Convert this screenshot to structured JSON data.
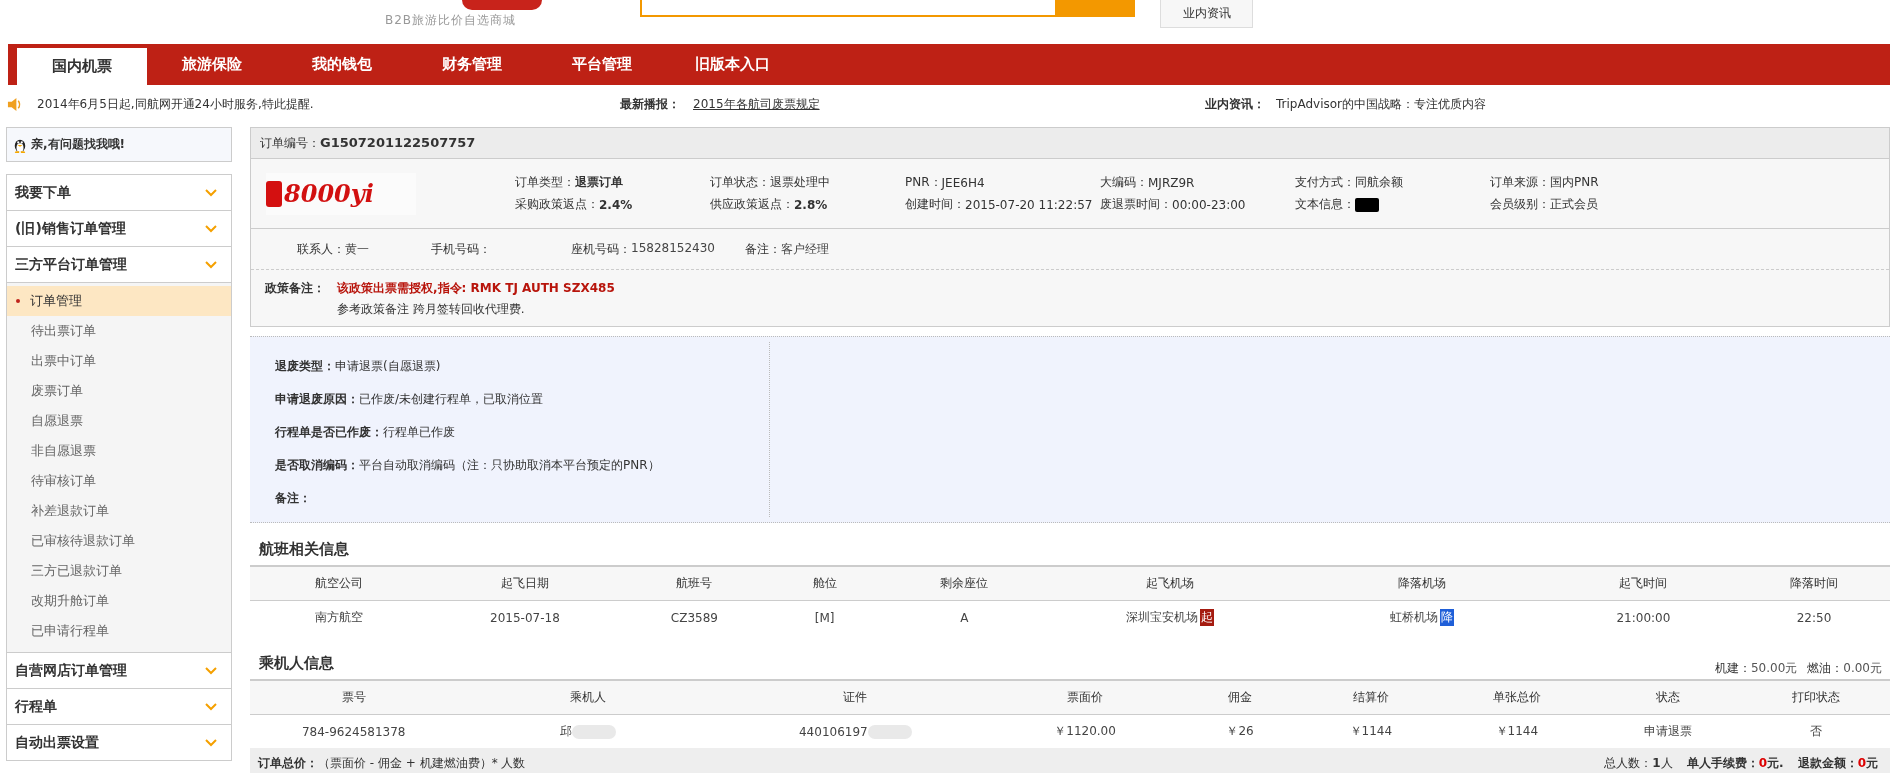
{
  "header": {
    "tagline": "B2B旅游比价自选商城",
    "news_button": "业内资讯"
  },
  "nav": [
    {
      "label": "国内机票",
      "selected": true
    },
    {
      "label": "旅游保险",
      "selected": false
    },
    {
      "label": "我的钱包",
      "selected": false
    },
    {
      "label": "财务管理",
      "selected": false
    },
    {
      "label": "平台管理",
      "selected": false
    },
    {
      "label": "旧版本入口",
      "selected": false
    }
  ],
  "notice": {
    "message": "2014年6月5日起,同航网开通24小时服务,特此提醒.",
    "latest_label": "最新播报：",
    "latest_link": "2015年各航司废票规定",
    "industry_label": "业内资讯：",
    "industry_link": "TripAdvisor的中国战略：专注优质内容"
  },
  "support": "亲,有问题找我哦!",
  "sidebar": {
    "items": [
      {
        "label": "我要下单"
      },
      {
        "label": "(旧)销售订单管理"
      },
      {
        "label": "三方平台订单管理",
        "children": [
          {
            "label": "订单管理",
            "selected": true
          },
          {
            "label": "待出票订单",
            "selected": false
          },
          {
            "label": "出票中订单",
            "selected": false
          },
          {
            "label": "废票订单",
            "selected": false
          },
          {
            "label": "自愿退票",
            "selected": false
          },
          {
            "label": "非自愿退票",
            "selected": false
          },
          {
            "label": "待审核订单",
            "selected": false
          },
          {
            "label": "补差退款订单",
            "selected": false
          },
          {
            "label": "已审核待退款订单",
            "selected": false
          },
          {
            "label": "三方已退款订单",
            "selected": false
          },
          {
            "label": "改期升舱订单",
            "selected": false
          },
          {
            "label": "已申请行程单",
            "selected": false
          }
        ]
      },
      {
        "label": "自营网店订单管理"
      },
      {
        "label": "行程单"
      },
      {
        "label": "自动出票设置"
      }
    ]
  },
  "order": {
    "number_label": "订单编号：",
    "number": "G1507201122507757",
    "logo": "8000yi",
    "fields": [
      {
        "label": "订单类型：",
        "value": "退票订单",
        "kind": "bold"
      },
      {
        "label": "采购政策返点：",
        "value": "2.4%",
        "kind": "bold"
      },
      {
        "label": "订单状态：",
        "value": "退票处理中",
        "kind": "plain"
      },
      {
        "label": "供应政策返点：",
        "value": "2.8%",
        "kind": "bold"
      },
      {
        "label": "PNR：",
        "value": "JEE6H4",
        "kind": "plain"
      },
      {
        "label": "创建时间：",
        "value": "2015-07-20 11:22:57",
        "kind": "plain"
      },
      {
        "label": "大编码：",
        "value": "MJRZ9R",
        "kind": "plain"
      },
      {
        "label": "废退票时间：",
        "value": "00:00-23:00",
        "kind": "plain"
      },
      {
        "label": "支付方式：",
        "value": "同航余额",
        "kind": "plain"
      },
      {
        "label": "文本信息：",
        "kind": "redacted"
      },
      {
        "label": "订单来源：",
        "value": "国内PNR",
        "kind": "plain"
      },
      {
        "label": "会员级别：",
        "value": "正式会员",
        "kind": "plain"
      }
    ],
    "contacts": [
      {
        "label": "联系人：",
        "value": "黄一"
      },
      {
        "label": "手机号码："
      },
      {
        "label": "座机号码：",
        "value": "15828152430"
      },
      {
        "label": "备注：",
        "value": "客户经理"
      }
    ],
    "policy": {
      "label": "政策备注：",
      "highlight": "该政策出票需授权,指令: RMK TJ AUTH SZX485",
      "note": "参考政策备注 跨月签转回收代理费."
    }
  },
  "refund": [
    {
      "label": "退废类型：",
      "value": "申请退票(自愿退票)"
    },
    {
      "label": "申请退废原因：",
      "value": "已作废/未创建行程单，已取消位置"
    },
    {
      "label": "行程单是否已作废：",
      "value": "行程单已作废"
    },
    {
      "label": "是否取消编码：",
      "value": "平台自动取消编码（注：只协助取消本平台预定的PNR）"
    },
    {
      "label": "备注："
    }
  ],
  "flight": {
    "title": "航班相关信息",
    "columns": [
      "航空公司",
      "起飞日期",
      "航班号",
      "舱位",
      "剩余座位",
      "起飞机场",
      "降落机场",
      "起飞时间",
      "降落时间"
    ],
    "rows": [
      [
        {
          "text": "南方航空"
        },
        {
          "text": "2015-07-18"
        },
        {
          "text": "CZ3589"
        },
        {
          "text": "[M]"
        },
        {
          "text": "A"
        },
        {
          "text": "深圳宝安机场",
          "badge": "起",
          "kind": "departure"
        },
        {
          "text": "虹桥机场",
          "badge": "降",
          "kind": "arrival"
        },
        {
          "text": "21:00:00"
        },
        {
          "text": "22:50"
        }
      ]
    ]
  },
  "passengers": {
    "title": "乘机人信息",
    "fees": [
      {
        "label": "机建：",
        "value": "50.00元"
      },
      {
        "label": "燃油：",
        "value": "0.00元"
      }
    ],
    "columns": [
      "票号",
      "乘机人",
      "证件",
      "票面价",
      "佣金",
      "结算价",
      "单张总价",
      "状态",
      "打印状态"
    ],
    "rows": [
      [
        {
          "text": "784-9624581378"
        },
        {
          "text": "邱",
          "masked": true
        },
        {
          "text": "440106197",
          "masked": true
        },
        {
          "text": "￥1120.00"
        },
        {
          "text": "￥26"
        },
        {
          "text": "￥1144"
        },
        {
          "text": "￥1144"
        },
        {
          "text": "申请退票"
        },
        {
          "text": "否"
        }
      ]
    ]
  },
  "totals": {
    "label": "订单总价：",
    "formula": "（票面价 - 佣金 + 机建燃油费）* 人数",
    "stats": [
      {
        "label": "总人数：",
        "value": "1",
        "unit": "人",
        "highlight": false
      },
      {
        "label": "单人手续费：",
        "value": "0",
        "unit": "元.",
        "highlight": true
      },
      {
        "label": "退款金额：",
        "value": "0",
        "unit": "元",
        "highlight": true
      }
    ]
  }
}
